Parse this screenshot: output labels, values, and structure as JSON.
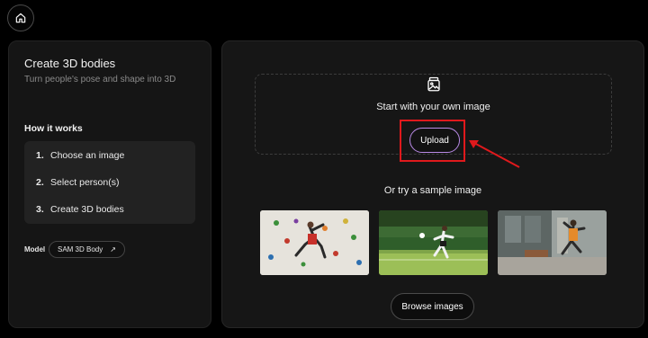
{
  "nav": {
    "home_icon": "home-icon"
  },
  "left_panel": {
    "title": "Create 3D bodies",
    "subtitle": "Turn people's pose and shape into 3D",
    "how_title": "How it works",
    "steps": [
      {
        "num": "1.",
        "label": "Choose an image"
      },
      {
        "num": "2.",
        "label": "Select person(s)"
      },
      {
        "num": "3.",
        "label": "Create 3D bodies"
      }
    ],
    "model_label": "Model",
    "model_name": "SAM 3D Body",
    "model_link_icon": "↗"
  },
  "right_panel": {
    "upload_icon": "image-icon",
    "start_text": "Start with your own image",
    "upload_label": "Upload",
    "sample_title": "Or try a sample image",
    "samples": [
      {
        "icon": "climber-sample-image"
      },
      {
        "icon": "soccer-sample-image"
      },
      {
        "icon": "dancer-sample-image"
      }
    ],
    "browse_label": "Browse images"
  },
  "colors": {
    "background": "#000000",
    "panel": "#151515",
    "upload_outline": "#b98ae6",
    "annotation_red": "#e0191c"
  }
}
